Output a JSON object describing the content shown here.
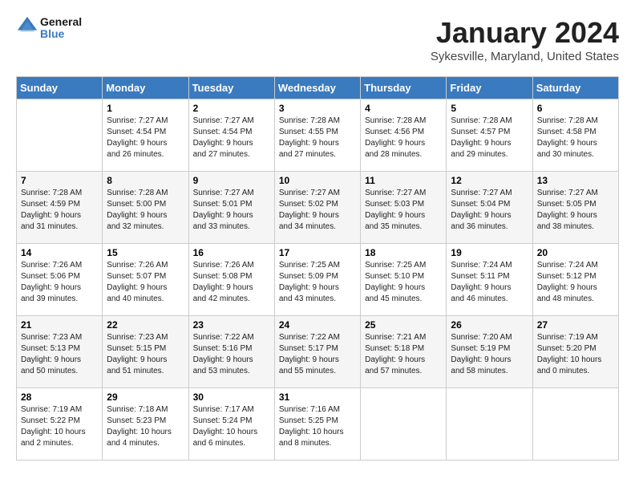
{
  "header": {
    "logo_general": "General",
    "logo_blue": "Blue",
    "month_title": "January 2024",
    "location": "Sykesville, Maryland, United States"
  },
  "days_of_week": [
    "Sunday",
    "Monday",
    "Tuesday",
    "Wednesday",
    "Thursday",
    "Friday",
    "Saturday"
  ],
  "weeks": [
    [
      {
        "day": "",
        "info": ""
      },
      {
        "day": "1",
        "info": "Sunrise: 7:27 AM\nSunset: 4:54 PM\nDaylight: 9 hours\nand 26 minutes."
      },
      {
        "day": "2",
        "info": "Sunrise: 7:27 AM\nSunset: 4:54 PM\nDaylight: 9 hours\nand 27 minutes."
      },
      {
        "day": "3",
        "info": "Sunrise: 7:28 AM\nSunset: 4:55 PM\nDaylight: 9 hours\nand 27 minutes."
      },
      {
        "day": "4",
        "info": "Sunrise: 7:28 AM\nSunset: 4:56 PM\nDaylight: 9 hours\nand 28 minutes."
      },
      {
        "day": "5",
        "info": "Sunrise: 7:28 AM\nSunset: 4:57 PM\nDaylight: 9 hours\nand 29 minutes."
      },
      {
        "day": "6",
        "info": "Sunrise: 7:28 AM\nSunset: 4:58 PM\nDaylight: 9 hours\nand 30 minutes."
      }
    ],
    [
      {
        "day": "7",
        "info": "Sunrise: 7:28 AM\nSunset: 4:59 PM\nDaylight: 9 hours\nand 31 minutes."
      },
      {
        "day": "8",
        "info": "Sunrise: 7:28 AM\nSunset: 5:00 PM\nDaylight: 9 hours\nand 32 minutes."
      },
      {
        "day": "9",
        "info": "Sunrise: 7:27 AM\nSunset: 5:01 PM\nDaylight: 9 hours\nand 33 minutes."
      },
      {
        "day": "10",
        "info": "Sunrise: 7:27 AM\nSunset: 5:02 PM\nDaylight: 9 hours\nand 34 minutes."
      },
      {
        "day": "11",
        "info": "Sunrise: 7:27 AM\nSunset: 5:03 PM\nDaylight: 9 hours\nand 35 minutes."
      },
      {
        "day": "12",
        "info": "Sunrise: 7:27 AM\nSunset: 5:04 PM\nDaylight: 9 hours\nand 36 minutes."
      },
      {
        "day": "13",
        "info": "Sunrise: 7:27 AM\nSunset: 5:05 PM\nDaylight: 9 hours\nand 38 minutes."
      }
    ],
    [
      {
        "day": "14",
        "info": "Sunrise: 7:26 AM\nSunset: 5:06 PM\nDaylight: 9 hours\nand 39 minutes."
      },
      {
        "day": "15",
        "info": "Sunrise: 7:26 AM\nSunset: 5:07 PM\nDaylight: 9 hours\nand 40 minutes."
      },
      {
        "day": "16",
        "info": "Sunrise: 7:26 AM\nSunset: 5:08 PM\nDaylight: 9 hours\nand 42 minutes."
      },
      {
        "day": "17",
        "info": "Sunrise: 7:25 AM\nSunset: 5:09 PM\nDaylight: 9 hours\nand 43 minutes."
      },
      {
        "day": "18",
        "info": "Sunrise: 7:25 AM\nSunset: 5:10 PM\nDaylight: 9 hours\nand 45 minutes."
      },
      {
        "day": "19",
        "info": "Sunrise: 7:24 AM\nSunset: 5:11 PM\nDaylight: 9 hours\nand 46 minutes."
      },
      {
        "day": "20",
        "info": "Sunrise: 7:24 AM\nSunset: 5:12 PM\nDaylight: 9 hours\nand 48 minutes."
      }
    ],
    [
      {
        "day": "21",
        "info": "Sunrise: 7:23 AM\nSunset: 5:13 PM\nDaylight: 9 hours\nand 50 minutes."
      },
      {
        "day": "22",
        "info": "Sunrise: 7:23 AM\nSunset: 5:15 PM\nDaylight: 9 hours\nand 51 minutes."
      },
      {
        "day": "23",
        "info": "Sunrise: 7:22 AM\nSunset: 5:16 PM\nDaylight: 9 hours\nand 53 minutes."
      },
      {
        "day": "24",
        "info": "Sunrise: 7:22 AM\nSunset: 5:17 PM\nDaylight: 9 hours\nand 55 minutes."
      },
      {
        "day": "25",
        "info": "Sunrise: 7:21 AM\nSunset: 5:18 PM\nDaylight: 9 hours\nand 57 minutes."
      },
      {
        "day": "26",
        "info": "Sunrise: 7:20 AM\nSunset: 5:19 PM\nDaylight: 9 hours\nand 58 minutes."
      },
      {
        "day": "27",
        "info": "Sunrise: 7:19 AM\nSunset: 5:20 PM\nDaylight: 10 hours\nand 0 minutes."
      }
    ],
    [
      {
        "day": "28",
        "info": "Sunrise: 7:19 AM\nSunset: 5:22 PM\nDaylight: 10 hours\nand 2 minutes."
      },
      {
        "day": "29",
        "info": "Sunrise: 7:18 AM\nSunset: 5:23 PM\nDaylight: 10 hours\nand 4 minutes."
      },
      {
        "day": "30",
        "info": "Sunrise: 7:17 AM\nSunset: 5:24 PM\nDaylight: 10 hours\nand 6 minutes."
      },
      {
        "day": "31",
        "info": "Sunrise: 7:16 AM\nSunset: 5:25 PM\nDaylight: 10 hours\nand 8 minutes."
      },
      {
        "day": "",
        "info": ""
      },
      {
        "day": "",
        "info": ""
      },
      {
        "day": "",
        "info": ""
      }
    ]
  ]
}
